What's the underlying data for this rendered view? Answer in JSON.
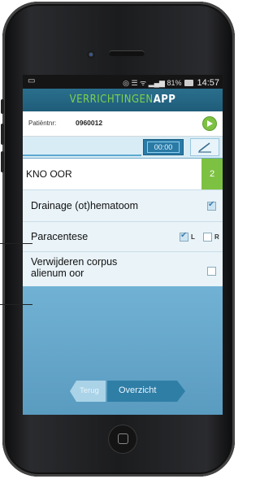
{
  "statusbar": {
    "icons_text": "◎ ☰ ᯤ ▂▄▆ 81%",
    "time": "14:57"
  },
  "app": {
    "title_part1": "VERRICHTINGEN",
    "title_part2": "APP"
  },
  "patient": {
    "label": "Patiëntnr:",
    "number": "0960012"
  },
  "timer": {
    "value": "00:00"
  },
  "section": {
    "name": "KNO OOR",
    "count": "2"
  },
  "items": [
    {
      "label": "Drainage (ot)hematoom",
      "checked": true
    },
    {
      "label": "Paracentese",
      "left_label": "L",
      "right_label": "R",
      "left_checked": true,
      "right_checked": false
    },
    {
      "label_line1": "Verwijderen corpus",
      "label_line2": "alienum oor",
      "checked": false
    }
  ],
  "buttons": {
    "back": "Terug",
    "overview": "Overzicht"
  },
  "colors": {
    "accent_green": "#7dc142",
    "header_blue": "#1f5d7a",
    "button_blue": "#2f7ea6"
  }
}
